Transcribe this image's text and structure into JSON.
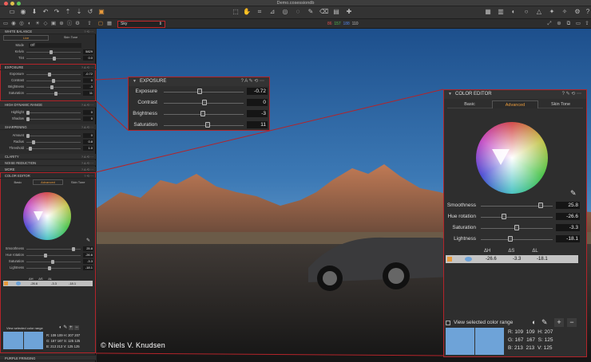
{
  "window": {
    "title": "Demo.cosessiondb"
  },
  "toolbar": {
    "icons": [
      "folder-icon",
      "camera-icon",
      "import-icon",
      "undo-icon",
      "redo-icon",
      "history-icon",
      "copy-icon",
      "paste-icon",
      "reset-icon",
      "cursor-icon",
      "pan-icon",
      "crop-icon",
      "straighten-icon",
      "keystone-icon",
      "spot-icon",
      "mask-draw-icon",
      "eraser-icon",
      "gradient-icon",
      "picker-icon",
      "grid-icon",
      "columns-icon",
      "proof-icon",
      "warning-icon",
      "settings-icon",
      "help-icon"
    ]
  },
  "layerbar": {
    "layer_name": "Sky",
    "readout_r": "86",
    "readout_g": "157",
    "readout_b": "188",
    "readout_l": "110"
  },
  "left": {
    "white_balance": {
      "title": "WHITE BALANCE",
      "tabs": [
        "Live",
        "Skin Tone"
      ],
      "mode_label": "Mode",
      "mode_value": "Off",
      "kelvin_label": "Kelvin",
      "kelvin_value": "5829",
      "tint_label": "Tint",
      "tint_value": "0.0"
    },
    "exposure": {
      "title": "EXPOSURE",
      "rows": [
        {
          "label": "Exposure",
          "value": "-0.72"
        },
        {
          "label": "Contrast",
          "value": "0"
        },
        {
          "label": "Brightness",
          "value": "-3"
        },
        {
          "label": "Saturation",
          "value": "11"
        }
      ]
    },
    "hdr": {
      "title": "HIGH DYNAMIC RANGE",
      "rows": [
        {
          "label": "Highlight",
          "value": "0"
        },
        {
          "label": "Shadow",
          "value": "0"
        }
      ]
    },
    "sharpening": {
      "title": "SHARPENING",
      "rows": [
        {
          "label": "Amount",
          "value": "0"
        },
        {
          "label": "Radius",
          "value": "0.8"
        },
        {
          "label": "Threshold",
          "value": "1.0"
        }
      ]
    },
    "clarity": {
      "title": "CLARITY"
    },
    "noise": {
      "title": "NOISE REDUCTION"
    },
    "more": {
      "title": "MORE"
    },
    "color_editor": {
      "title": "COLOR EDITOR",
      "tabs": [
        "Basic",
        "Advanced",
        "Skin Tone"
      ],
      "rows": [
        {
          "label": "Smoothness",
          "value": "25.8"
        },
        {
          "label": "Hue rotation",
          "value": "-26.6"
        },
        {
          "label": "Saturation",
          "value": "-3.3"
        },
        {
          "label": "Lightness",
          "value": "-18.1"
        }
      ],
      "delta_h": "ΔH",
      "delta_s": "ΔS",
      "delta_l": "ΔL",
      "dh": "-26.6",
      "ds": "-3.3",
      "dl": "-18.1",
      "view_range": "View selected color range",
      "rgb": {
        "r": "109",
        "g": "167",
        "b": "213",
        "r2": "109",
        "g2": "167",
        "b2": "213",
        "h": "207",
        "s": "125",
        "v": "125",
        "h2": "207",
        "s2": "125",
        "v2": "125"
      }
    },
    "purple_fringing": {
      "title": "PURPLE FRINGING"
    }
  },
  "popup_exposure": {
    "title": "EXPOSURE",
    "rows": [
      {
        "label": "Exposure",
        "value": "-0.72"
      },
      {
        "label": "Contrast",
        "value": "0"
      },
      {
        "label": "Brightness",
        "value": "-3"
      },
      {
        "label": "Saturation",
        "value": "11"
      }
    ]
  },
  "popup_color": {
    "title": "COLOR EDITOR",
    "tabs": [
      "Basic",
      "Advanced",
      "Skin Tone"
    ],
    "rows": [
      {
        "label": "Smoothness",
        "value": "25.8"
      },
      {
        "label": "Hue rotation",
        "value": "-26.6"
      },
      {
        "label": "Saturation",
        "value": "-3.3"
      },
      {
        "label": "Lightness",
        "value": "-18.1"
      }
    ],
    "delta_h": "ΔH",
    "delta_s": "ΔS",
    "delta_l": "ΔL",
    "dh": "-26.6",
    "ds": "-3.3",
    "dl": "-18.1",
    "view_range": "View selected color range",
    "r_label": "R:",
    "g_label": "G:",
    "b_label": "B:",
    "h_label": "H:",
    "s_label": "S:",
    "v_label": "V:",
    "r1": "109",
    "r2": "109",
    "h": "207",
    "g1": "167",
    "g2": "167",
    "s": "125",
    "b1": "213",
    "b2": "213",
    "v": "125",
    "plus": "+",
    "minus": "−"
  },
  "copyright": "© Niels V. Knudsen",
  "colors": {
    "accent": "#e89a3c",
    "highlight_red": "#b3242a",
    "swatch": "#6ea3d8"
  }
}
